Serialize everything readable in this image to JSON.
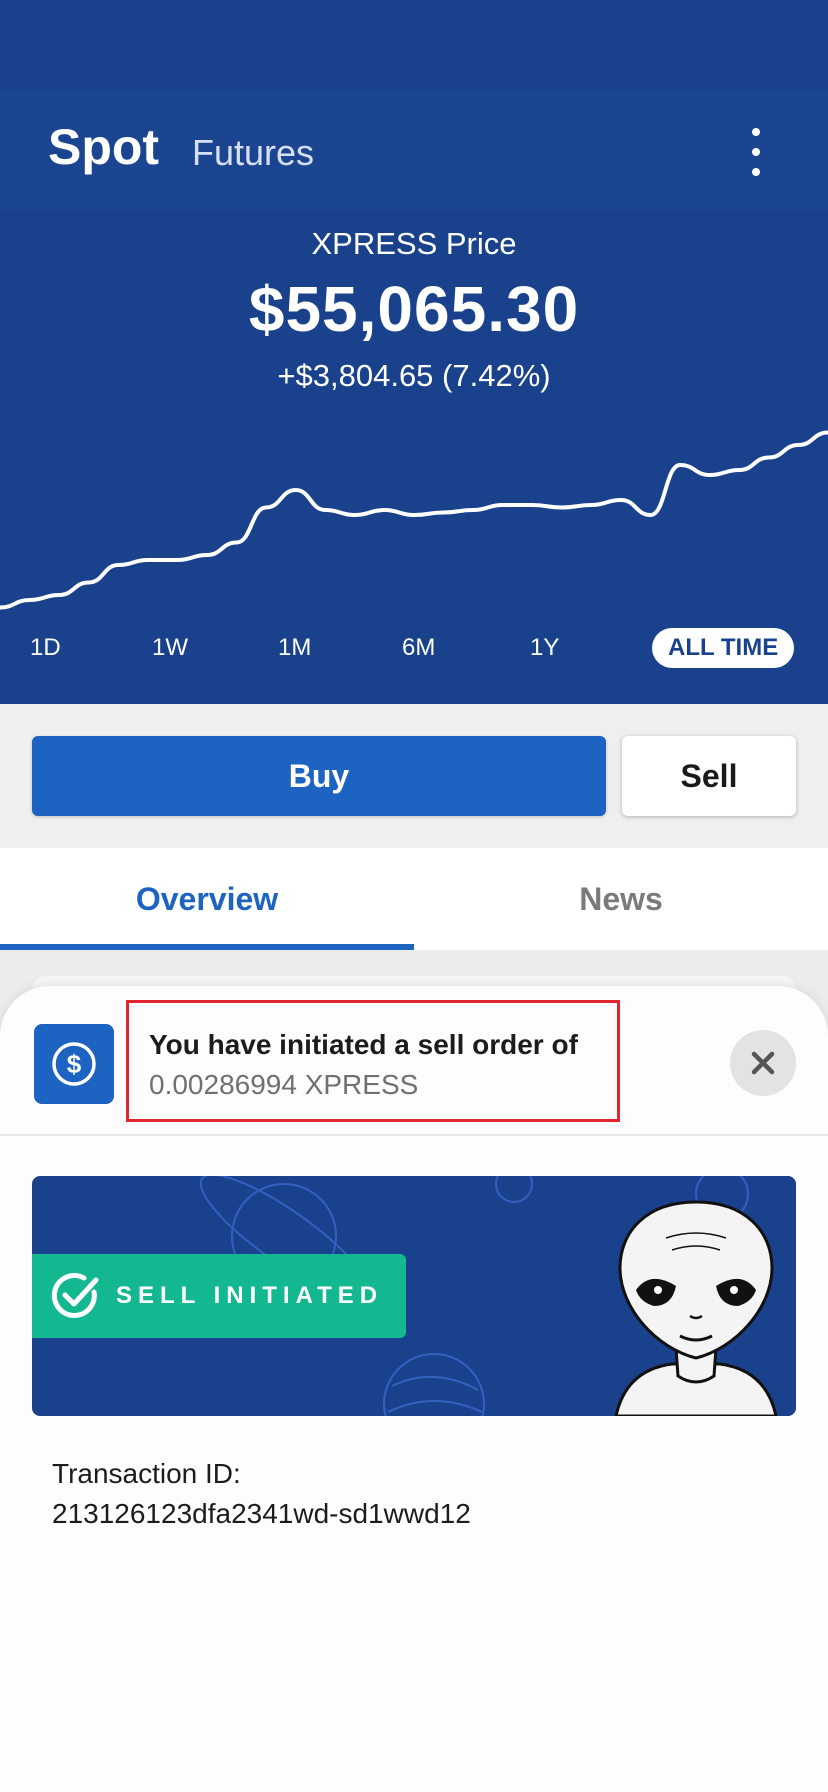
{
  "header": {
    "tab_spot": "Spot",
    "tab_futures": "Futures",
    "more_icon": "more-vertical-icon"
  },
  "price": {
    "label": "XPRESS Price",
    "value": "$55,065.30",
    "change": "+$3,804.65 (7.42%)"
  },
  "chart_data": {
    "type": "line",
    "series": [
      {
        "values": [
          5,
          8,
          10,
          15,
          22,
          24,
          24,
          26,
          31,
          45,
          52,
          44,
          42,
          44,
          42,
          43,
          44,
          46,
          46,
          45,
          46,
          48,
          42,
          62,
          58,
          60,
          65,
          70,
          75
        ]
      }
    ],
    "ylim": [
      0,
      80
    ],
    "grid": false,
    "color": "#ffffff"
  },
  "ranges": [
    "1D",
    "1W",
    "1M",
    "6M",
    "1Y",
    "ALL TIME"
  ],
  "active_range": "ALL TIME",
  "actions": {
    "buy": "Buy",
    "sell": "Sell"
  },
  "tabs": {
    "overview": "Overview",
    "news": "News"
  },
  "notification": {
    "icon": "dollar-circle-icon",
    "title": "You have initiated a sell order of",
    "amount": "0.00286994 XPRESS",
    "close_icon": "close-icon"
  },
  "banner": {
    "badge_text": "SELL INITIATED",
    "badge_icon": "check-circle-icon",
    "illustration": "alien-illustration"
  },
  "transaction": {
    "label": "Transaction ID:",
    "id": "213126123dfa2341wd-sd1wwd12"
  },
  "colors": {
    "primary_dark": "#1a428c",
    "primary": "#1d63c1",
    "success": "#13b891",
    "highlight_border": "#e0262e"
  }
}
